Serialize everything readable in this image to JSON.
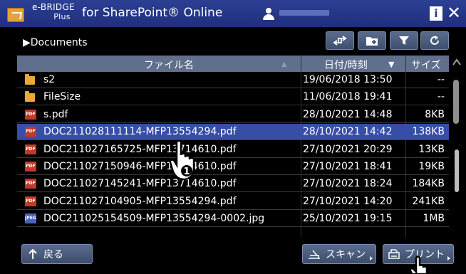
{
  "titlebar": {
    "brand_line1": "e-BRIDGE",
    "brand_line2": "Plus",
    "title": "for SharePoint® Online"
  },
  "path": {
    "label": "▶Documents"
  },
  "table": {
    "columns": [
      "ファイル名",
      "日付/時刻",
      "サイズ"
    ],
    "rows": [
      {
        "type": "folder",
        "name": "s2",
        "date": "19/06/2018 13:50",
        "size": "--",
        "selected": false
      },
      {
        "type": "folder",
        "name": "FileSize",
        "date": "11/06/2018 19:41",
        "size": "--",
        "selected": false
      },
      {
        "type": "pdf",
        "name": "s.pdf",
        "date": "28/10/2021 14:48",
        "size": "8KB",
        "selected": false
      },
      {
        "type": "pdf",
        "name": "DOC211028111114-MFP13554294.pdf",
        "date": "28/10/2021 14:42",
        "size": "138KB",
        "selected": true
      },
      {
        "type": "pdf",
        "name": "DOC211027165725-MFP13714610.pdf",
        "date": "27/10/2021 20:29",
        "size": "13KB",
        "selected": false
      },
      {
        "type": "pdf",
        "name": "DOC211027150946-MFP13714610.pdf",
        "date": "27/10/2021 18:41",
        "size": "19KB",
        "selected": false
      },
      {
        "type": "pdf",
        "name": "DOC211027145241-MFP13714610.pdf",
        "date": "27/10/2021 18:24",
        "size": "184KB",
        "selected": false
      },
      {
        "type": "pdf",
        "name": "DOC211027104905-MFP13554294.pdf",
        "date": "27/10/2021 14:20",
        "size": "241KB",
        "selected": false
      },
      {
        "type": "jpg",
        "name": "DOC211025154509-MFP13554294-0002.jpg",
        "date": "25/10/2021 19:15",
        "size": "1MB",
        "selected": false
      }
    ]
  },
  "buttons": {
    "back": "戻る",
    "scan": "スキャン",
    "print": "プリント"
  },
  "icons": {
    "pdf_label": "PDF",
    "jpg_label": "JPEG"
  },
  "callout": {
    "step": "1"
  },
  "colors": {
    "titlebar": "#24388a",
    "selected_row": "#374ea8",
    "header": "#5f6f8c",
    "pdf_icon": "#c0392b",
    "folder_icon": "#e8a93a"
  }
}
